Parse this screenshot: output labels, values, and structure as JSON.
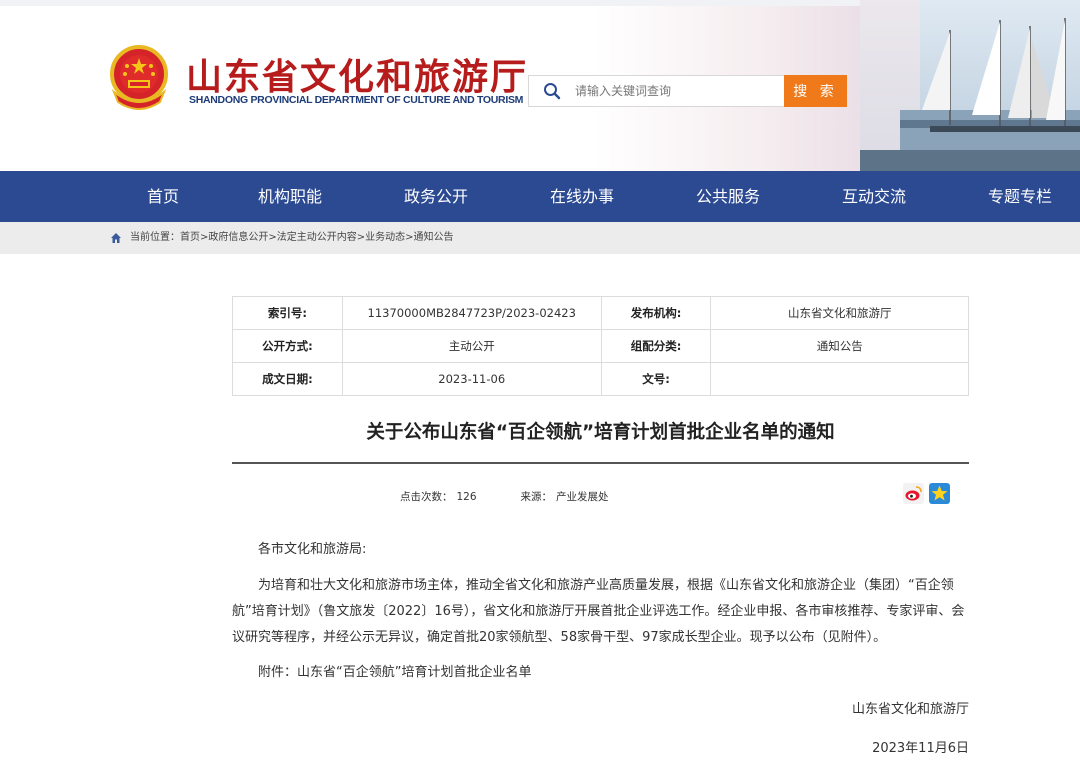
{
  "header": {
    "title": "山东省文化和旅游厅",
    "subtitle": "SHANDONG PROVINCIAL DEPARTMENT OF CULTURE AND TOURISM",
    "search_placeholder": "请输入关键词查询",
    "search_button": "搜 索"
  },
  "nav": {
    "items": [
      "首页",
      "机构职能",
      "政务公开",
      "在线办事",
      "公共服务",
      "互动交流",
      "专题专栏"
    ]
  },
  "breadcrumb": {
    "text": "当前位置：首页>政府信息公开>法定主动公开内容>业务动态>通知公告"
  },
  "meta": {
    "rows": [
      {
        "k1": "索引号:",
        "v1": "11370000MB2847723P/2023-02423",
        "k2": "发布机构:",
        "v2": "山东省文化和旅游厅"
      },
      {
        "k1": "公开方式:",
        "v1": "主动公开",
        "k2": "组配分类:",
        "v2": "通知公告"
      },
      {
        "k1": "成文日期:",
        "v1": "2023-11-06",
        "k2": "文号:",
        "v2": ""
      }
    ]
  },
  "article": {
    "title": "关于公布山东省“百企领航”培育计划首批企业名单的通知",
    "clicks_label": "点击次数：",
    "clicks": "126",
    "source_label": "来源：",
    "source": "产业发展处",
    "salutation": "各市文化和旅游局:",
    "paragraph": "为培育和壮大文化和旅游市场主体，推动全省文化和旅游产业高质量发展，根据《山东省文化和旅游企业（集团）“百企领航”培育计划》（鲁文旅发〔2022〕16号），省文化和旅游厅开展首批企业评选工作。经企业申报、各市审核推荐、专家评审、会议研究等程序，并经公示无异议，确定首批20家领航型、58家骨干型、97家成长型企业。现予以公布（见附件）。",
    "attachment": "附件：山东省“百企领航”培育计划首批企业名单",
    "signature": "山东省文化和旅游厅",
    "date": "2023年11月6日"
  },
  "colors": {
    "title_red": "#b71c1c",
    "nav_blue": "#2b4a92",
    "search_orange": "#f07a1a"
  },
  "icons": [
    "national-emblem",
    "search-icon",
    "home-icon",
    "weibo-icon",
    "qzone-star-icon"
  ]
}
